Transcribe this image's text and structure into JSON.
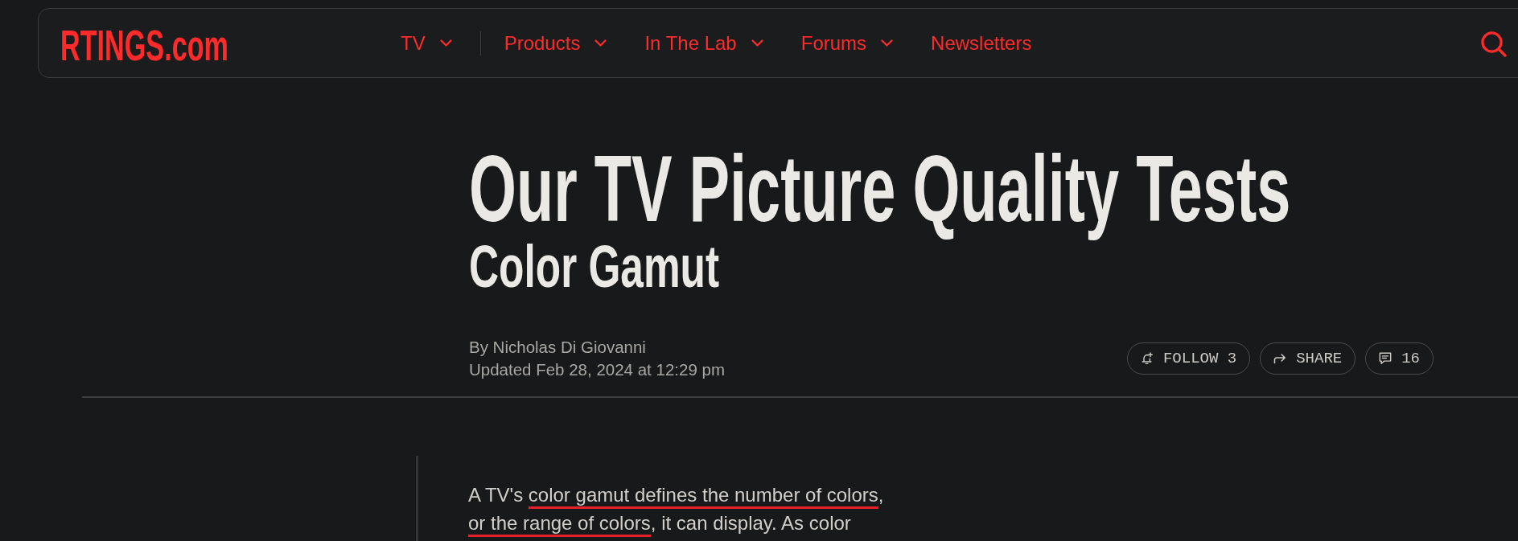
{
  "header": {
    "logo": "RTINGS.com",
    "nav": [
      {
        "kind": "dropdown",
        "label": "TV"
      },
      {
        "kind": "divider"
      },
      {
        "kind": "dropdown",
        "label": "Products"
      },
      {
        "kind": "dropdown",
        "label": "In The Lab"
      },
      {
        "kind": "dropdown",
        "label": "Forums"
      },
      {
        "kind": "link",
        "label": "Newsletters"
      }
    ]
  },
  "article": {
    "title": "Our TV Picture Quality Tests",
    "subtitle": "Color Gamut",
    "author": "By Nicholas Di Giovanni",
    "updated": "Updated Feb 28, 2024 at 12:29 pm",
    "actions": [
      {
        "kind": "follow",
        "label": "FOLLOW 3"
      },
      {
        "kind": "share",
        "label": "SHARE"
      },
      {
        "kind": "comments",
        "label": "16"
      }
    ],
    "paragraph": [
      {
        "text": "A TV's ",
        "underlined": false
      },
      {
        "text": "color gamut defines the number of colors",
        "underlined": true
      },
      {
        "text": ", ",
        "underlined": false
      },
      {
        "text": "or the range of colors",
        "underlined": true
      },
      {
        "text": ", it can display. As color",
        "underlined": false
      }
    ]
  }
}
